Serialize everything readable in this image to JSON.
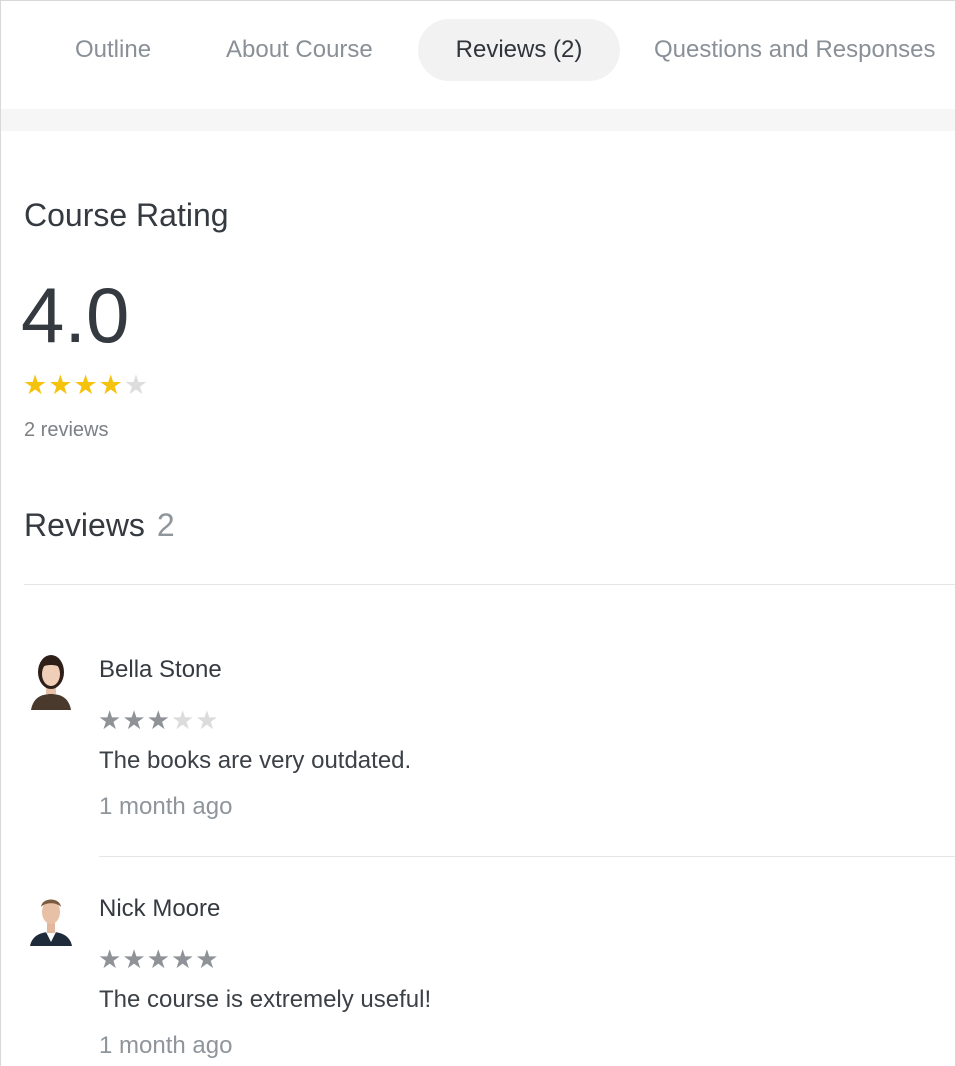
{
  "tabs": [
    {
      "label": "Outline",
      "active": false
    },
    {
      "label": "About Course",
      "active": false
    },
    {
      "label": "Reviews (2)",
      "active": true
    },
    {
      "label": "Questions and Responses",
      "active": false
    }
  ],
  "rating": {
    "title": "Course Rating",
    "value": "4.0",
    "stars_filled": 4,
    "stars_total": 5,
    "review_count_text": "2 reviews"
  },
  "reviews_section": {
    "heading": "Reviews",
    "count": "2"
  },
  "reviews": [
    {
      "name": "Bella Stone",
      "stars_filled": 3,
      "stars_total": 5,
      "text": "The books are very outdated.",
      "time": "1 month ago"
    },
    {
      "name": "Nick Moore",
      "stars_filled": 5,
      "stars_total": 5,
      "text": "The course is extremely useful!",
      "time": "1 month ago"
    }
  ],
  "colors": {
    "star_active": "#f5c30d",
    "star_review": "#8f9398",
    "star_empty": "#dddddd",
    "tab_active_bg": "#f2f2f2"
  }
}
